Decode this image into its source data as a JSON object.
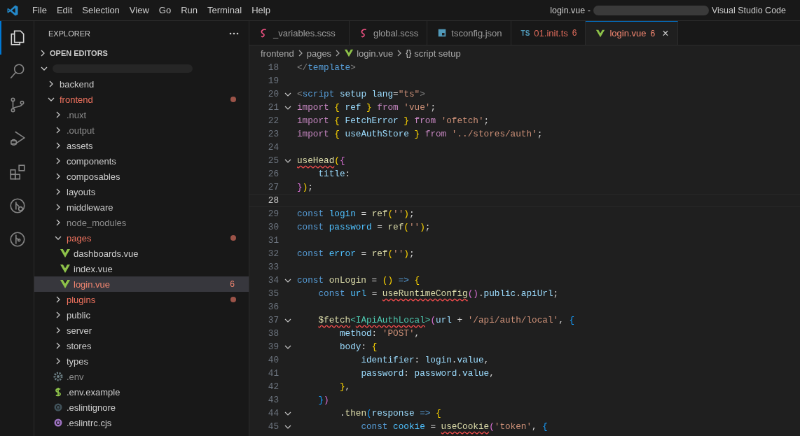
{
  "title_bar": {
    "menus": [
      "File",
      "Edit",
      "Selection",
      "View",
      "Go",
      "Run",
      "Terminal",
      "Help"
    ],
    "title_start": "login.vue -",
    "title_end": "Visual Studio Code"
  },
  "activity_bar": [
    {
      "kind": "explorer",
      "selected": true
    },
    {
      "kind": "search",
      "selected": false
    },
    {
      "kind": "source_control",
      "selected": false
    },
    {
      "kind": "debug",
      "selected": false
    },
    {
      "kind": "extensions",
      "selected": false
    },
    {
      "kind": "branch_search",
      "selected": false
    },
    {
      "kind": "branch_circle",
      "selected": false
    }
  ],
  "sidebar": {
    "title": "EXPLORER",
    "open_editors": {
      "label": "OPEN EDITORS",
      "expanded": false
    },
    "root": {
      "expanded": true
    },
    "tree": [
      {
        "label": "backend",
        "kind": "folder",
        "expanded": false,
        "color": "#cccccc",
        "modified": false,
        "selected": false
      },
      {
        "label": "frontend",
        "kind": "folder",
        "expanded": true,
        "color": "#f1735f",
        "modified": true,
        "selected": false,
        "children": [
          {
            "label": ".nuxt",
            "kind": "folder",
            "expanded": false,
            "color": "#8c8c8c",
            "modified": false,
            "selected": false
          },
          {
            "label": ".output",
            "kind": "folder",
            "expanded": false,
            "color": "#8c8c8c",
            "modified": false,
            "selected": false
          },
          {
            "label": "assets",
            "kind": "folder",
            "expanded": false,
            "color": "#cccccc",
            "modified": false,
            "selected": false
          },
          {
            "label": "components",
            "kind": "folder",
            "expanded": false,
            "color": "#cccccc",
            "modified": false,
            "selected": false
          },
          {
            "label": "composables",
            "kind": "folder",
            "expanded": false,
            "color": "#cccccc",
            "modified": false,
            "selected": false
          },
          {
            "label": "layouts",
            "kind": "folder",
            "expanded": false,
            "color": "#cccccc",
            "modified": false,
            "selected": false
          },
          {
            "label": "middleware",
            "kind": "folder",
            "expanded": false,
            "color": "#cccccc",
            "modified": false,
            "selected": false
          },
          {
            "label": "node_modules",
            "kind": "folder",
            "expanded": false,
            "color": "#8c8c8c",
            "modified": false,
            "selected": false
          },
          {
            "label": "pages",
            "kind": "folder",
            "expanded": true,
            "color": "#f1735f",
            "modified": true,
            "selected": false,
            "children": [
              {
                "label": "dashboards.vue",
                "kind": "vue",
                "color": "#cccccc",
                "modified": false,
                "selected": false
              },
              {
                "label": "index.vue",
                "kind": "vue",
                "color": "#cccccc",
                "modified": false,
                "selected": false
              },
              {
                "label": "login.vue",
                "kind": "vue",
                "color": "#f48771",
                "modified": false,
                "badge": "6",
                "selected": true
              }
            ]
          },
          {
            "label": "plugins",
            "kind": "folder",
            "expanded": false,
            "color": "#f1735f",
            "modified": true,
            "selected": false
          },
          {
            "label": "public",
            "kind": "folder",
            "expanded": false,
            "color": "#cccccc",
            "modified": false,
            "selected": false
          },
          {
            "label": "server",
            "kind": "folder",
            "expanded": false,
            "color": "#cccccc",
            "modified": false,
            "selected": false
          },
          {
            "label": "stores",
            "kind": "folder",
            "expanded": false,
            "color": "#cccccc",
            "modified": false,
            "selected": false
          },
          {
            "label": "types",
            "kind": "folder",
            "expanded": false,
            "color": "#cccccc",
            "modified": false,
            "selected": false
          },
          {
            "label": ".env",
            "kind": "settings",
            "color": "#8c8c8c",
            "modified": false,
            "selected": false
          },
          {
            "label": ".env.example",
            "kind": "dollar",
            "color": "#cccccc",
            "modified": false,
            "selected": false
          },
          {
            "label": ".eslintignore",
            "kind": "ignore",
            "color": "#cccccc",
            "modified": false,
            "selected": false
          },
          {
            "label": ".eslintrc.cjs",
            "kind": "eslint",
            "color": "#cccccc",
            "modified": false,
            "selected": false
          }
        ]
      }
    ]
  },
  "tabs": [
    {
      "label": "_variables.scss",
      "kind": "sass",
      "color": "#9d9d9d",
      "selected": false
    },
    {
      "label": "global.scss",
      "kind": "sass",
      "color": "#9d9d9d",
      "selected": false
    },
    {
      "label": "tsconfig.json",
      "kind": "config",
      "color": "#9d9d9d",
      "selected": false
    },
    {
      "label": "01.init.ts",
      "kind": "ts",
      "icon_label": "TS",
      "color": "#e06c5c",
      "badge": "6",
      "selected": false
    },
    {
      "label": "login.vue",
      "kind": "vue",
      "color": "#f48771",
      "badge": "6",
      "selected": true,
      "close": "×"
    }
  ],
  "breadcrumbs": [
    {
      "label": "frontend",
      "kind": "folder"
    },
    {
      "label": "pages",
      "kind": "folder"
    },
    {
      "label": "login.vue",
      "kind": "vue"
    },
    {
      "label": "script setup",
      "kind": "symbol",
      "icon_label": "{}"
    }
  ],
  "editor": {
    "lines": [
      {
        "number": "18",
        "fold": false,
        "current": false,
        "tokens": [
          {
            "text": "</",
            "kind": "tag"
          },
          {
            "text": "template",
            "kind": "tagname"
          },
          {
            "text": ">",
            "kind": "tag"
          }
        ]
      },
      {
        "number": "19",
        "fold": false,
        "current": false
      },
      {
        "number": "20",
        "fold": true,
        "current": false,
        "tokens": [
          {
            "text": "<",
            "kind": "tag"
          },
          {
            "text": "script",
            "kind": "tagname"
          },
          {
            "text": " setup lang",
            "kind": "attr"
          },
          {
            "text": "=",
            "kind": "punct"
          },
          {
            "text": "\"ts\"",
            "kind": "str"
          },
          {
            "text": ">",
            "kind": "tag"
          }
        ]
      },
      {
        "number": "21",
        "fold": true,
        "current": false,
        "tokens": [
          {
            "text": "import ",
            "kind": "kw"
          },
          {
            "text": "{",
            "kind": "br1"
          },
          {
            "text": " ref ",
            "kind": "var"
          },
          {
            "text": "}",
            "kind": "br1"
          },
          {
            "text": " from ",
            "kind": "kw"
          },
          {
            "text": "'vue'",
            "kind": "str"
          },
          {
            "text": ";",
            "kind": "punct"
          }
        ]
      },
      {
        "number": "22",
        "fold": false,
        "current": false,
        "tokens": [
          {
            "text": "import ",
            "kind": "kw"
          },
          {
            "text": "{",
            "kind": "br1"
          },
          {
            "text": " FetchError ",
            "kind": "var"
          },
          {
            "text": "}",
            "kind": "br1"
          },
          {
            "text": " from ",
            "kind": "kw"
          },
          {
            "text": "'ofetch'",
            "kind": "str"
          },
          {
            "text": ";",
            "kind": "punct"
          }
        ]
      },
      {
        "number": "23",
        "fold": false,
        "current": false,
        "tokens": [
          {
            "text": "import ",
            "kind": "kw"
          },
          {
            "text": "{",
            "kind": "br1"
          },
          {
            "text": " useAuthStore ",
            "kind": "var"
          },
          {
            "text": "}",
            "kind": "br1"
          },
          {
            "text": " from ",
            "kind": "kw"
          },
          {
            "text": "'../stores/auth'",
            "kind": "str"
          },
          {
            "text": ";",
            "kind": "punct"
          }
        ]
      },
      {
        "number": "24",
        "fold": false,
        "current": false
      },
      {
        "number": "25",
        "fold": true,
        "current": false,
        "tokens": [
          {
            "text": "useHead",
            "kind": "fn_err"
          },
          {
            "text": "(",
            "kind": "br1"
          },
          {
            "text": "{",
            "kind": "br2"
          }
        ]
      },
      {
        "number": "26",
        "fold": false,
        "current": false,
        "tokens": [
          {
            "text": "    title",
            "kind": "var"
          },
          {
            "text": ":",
            "kind": "punct"
          }
        ]
      },
      {
        "number": "27",
        "fold": false,
        "current": false,
        "tokens": [
          {
            "text": "}",
            "kind": "br2"
          },
          {
            "text": ")",
            "kind": "br1"
          },
          {
            "text": ";",
            "kind": "punct"
          }
        ]
      },
      {
        "number": "28",
        "fold": false,
        "current": true
      },
      {
        "number": "29",
        "fold": false,
        "current": false,
        "tokens": [
          {
            "text": "const ",
            "kind": "kw2"
          },
          {
            "text": "login",
            "kind": "cvar"
          },
          {
            "text": " = ",
            "kind": "punct"
          },
          {
            "text": "ref",
            "kind": "fn"
          },
          {
            "text": "(",
            "kind": "br1"
          },
          {
            "text": "''",
            "kind": "str"
          },
          {
            "text": ")",
            "kind": "br1"
          },
          {
            "text": ";",
            "kind": "punct"
          }
        ]
      },
      {
        "number": "30",
        "fold": false,
        "current": false,
        "tokens": [
          {
            "text": "const ",
            "kind": "kw2"
          },
          {
            "text": "password",
            "kind": "cvar"
          },
          {
            "text": " = ",
            "kind": "punct"
          },
          {
            "text": "ref",
            "kind": "fn"
          },
          {
            "text": "(",
            "kind": "br1"
          },
          {
            "text": "''",
            "kind": "str"
          },
          {
            "text": ")",
            "kind": "br1"
          },
          {
            "text": ";",
            "kind": "punct"
          }
        ]
      },
      {
        "number": "31",
        "fold": false,
        "current": false
      },
      {
        "number": "32",
        "fold": false,
        "current": false,
        "tokens": [
          {
            "text": "const ",
            "kind": "kw2"
          },
          {
            "text": "error",
            "kind": "cvar"
          },
          {
            "text": " = ",
            "kind": "punct"
          },
          {
            "text": "ref",
            "kind": "fn"
          },
          {
            "text": "(",
            "kind": "br1"
          },
          {
            "text": "''",
            "kind": "str"
          },
          {
            "text": ")",
            "kind": "br1"
          },
          {
            "text": ";",
            "kind": "punct"
          }
        ]
      },
      {
        "number": "33",
        "fold": false,
        "current": false
      },
      {
        "number": "34",
        "fold": true,
        "current": false,
        "tokens": [
          {
            "text": "const ",
            "kind": "kw2"
          },
          {
            "text": "onLogin",
            "kind": "fn"
          },
          {
            "text": " = ",
            "kind": "punct"
          },
          {
            "text": "()",
            "kind": "br1"
          },
          {
            "text": " => ",
            "kind": "kw2"
          },
          {
            "text": "{",
            "kind": "br1"
          }
        ]
      },
      {
        "number": "35",
        "fold": false,
        "current": false,
        "tokens": [
          {
            "text": "    const ",
            "kind": "kw2"
          },
          {
            "text": "url",
            "kind": "cvar"
          },
          {
            "text": " = ",
            "kind": "punct"
          },
          {
            "text": "useRuntimeConfig",
            "kind": "fn_err"
          },
          {
            "text": "()",
            "kind": "br2"
          },
          {
            "text": ".",
            "kind": "punct"
          },
          {
            "text": "public",
            "kind": "var"
          },
          {
            "text": ".",
            "kind": "punct"
          },
          {
            "text": "apiUrl",
            "kind": "var"
          },
          {
            "text": ";",
            "kind": "punct"
          }
        ]
      },
      {
        "number": "36",
        "fold": false,
        "current": false
      },
      {
        "number": "37",
        "fold": true,
        "current": false,
        "tokens": [
          {
            "text": "    $fetch",
            "kind": "fn_err"
          },
          {
            "text": "<",
            "kind": "type"
          },
          {
            "text": "IApiAuthLocal",
            "kind": "type_err"
          },
          {
            "text": ">",
            "kind": "type"
          },
          {
            "text": "(",
            "kind": "br2"
          },
          {
            "text": "url",
            "kind": "var"
          },
          {
            "text": " + ",
            "kind": "punct"
          },
          {
            "text": "'/api/auth/local'",
            "kind": "str"
          },
          {
            "text": ", ",
            "kind": "punct"
          },
          {
            "text": "{",
            "kind": "br3"
          }
        ]
      },
      {
        "number": "38",
        "fold": false,
        "current": false,
        "tokens": [
          {
            "text": "        method",
            "kind": "var"
          },
          {
            "text": ": ",
            "kind": "punct"
          },
          {
            "text": "'POST'",
            "kind": "str"
          },
          {
            "text": ",",
            "kind": "punct"
          }
        ]
      },
      {
        "number": "39",
        "fold": true,
        "current": false,
        "tokens": [
          {
            "text": "        body",
            "kind": "var"
          },
          {
            "text": ": ",
            "kind": "punct"
          },
          {
            "text": "{",
            "kind": "br1"
          }
        ]
      },
      {
        "number": "40",
        "fold": false,
        "current": false,
        "tokens": [
          {
            "text": "            identifier",
            "kind": "var"
          },
          {
            "text": ": ",
            "kind": "punct"
          },
          {
            "text": "login",
            "kind": "var"
          },
          {
            "text": ".",
            "kind": "punct"
          },
          {
            "text": "value",
            "kind": "var"
          },
          {
            "text": ",",
            "kind": "punct"
          }
        ]
      },
      {
        "number": "41",
        "fold": false,
        "current": false,
        "tokens": [
          {
            "text": "            password",
            "kind": "var"
          },
          {
            "text": ": ",
            "kind": "punct"
          },
          {
            "text": "password",
            "kind": "var"
          },
          {
            "text": ".",
            "kind": "punct"
          },
          {
            "text": "value",
            "kind": "var"
          },
          {
            "text": ",",
            "kind": "punct"
          }
        ]
      },
      {
        "number": "42",
        "fold": false,
        "current": false,
        "tokens": [
          {
            "text": "        }",
            "kind": "br1"
          },
          {
            "text": ",",
            "kind": "punct"
          }
        ]
      },
      {
        "number": "43",
        "fold": false,
        "current": false,
        "tokens": [
          {
            "text": "    }",
            "kind": "br3"
          },
          {
            "text": ")",
            "kind": "br2"
          }
        ]
      },
      {
        "number": "44",
        "fold": true,
        "current": false,
        "tokens": [
          {
            "text": "        .",
            "kind": "punct"
          },
          {
            "text": "then",
            "kind": "fn"
          },
          {
            "text": "(",
            "kind": "br3"
          },
          {
            "text": "response",
            "kind": "var"
          },
          {
            "text": " => ",
            "kind": "kw2"
          },
          {
            "text": "{",
            "kind": "br1"
          }
        ]
      },
      {
        "number": "45",
        "fold": true,
        "current": false,
        "tokens": [
          {
            "text": "            const ",
            "kind": "kw2"
          },
          {
            "text": "cookie",
            "kind": "cvar"
          },
          {
            "text": " = ",
            "kind": "punct"
          },
          {
            "text": "useCookie",
            "kind": "fn_err"
          },
          {
            "text": "(",
            "kind": "br2"
          },
          {
            "text": "'token'",
            "kind": "str"
          },
          {
            "text": ", ",
            "kind": "punct"
          },
          {
            "text": "{",
            "kind": "br3"
          }
        ]
      }
    ]
  }
}
